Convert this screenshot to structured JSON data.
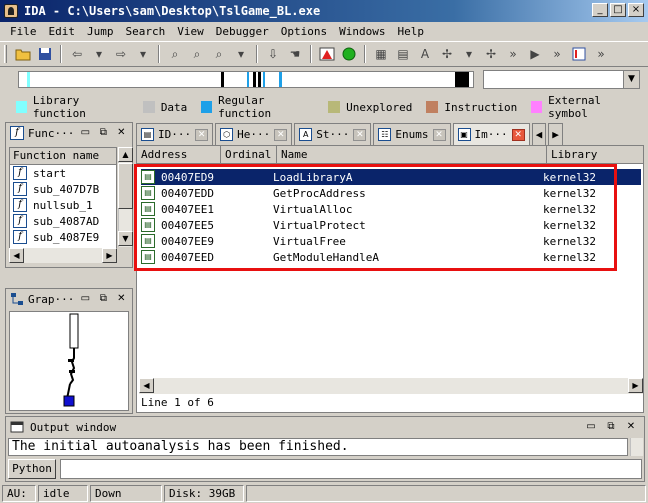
{
  "window": {
    "title": "IDA - C:\\Users\\sam\\Desktop\\TslGame_BL.exe",
    "min": "_",
    "max": "□",
    "close": "×"
  },
  "menu": [
    "File",
    "Edit",
    "Jump",
    "Search",
    "View",
    "Debugger",
    "Options",
    "Windows",
    "Help"
  ],
  "legend": [
    {
      "label": "Library function",
      "color": "#80ffff"
    },
    {
      "label": "Data",
      "color": "#c0c0c0"
    },
    {
      "label": "Regular function",
      "color": "#1ea0e8"
    },
    {
      "label": "Unexplored",
      "color": "#b8b878"
    },
    {
      "label": "Instruction",
      "color": "#c08060"
    },
    {
      "label": "External symbol",
      "color": "#ff80ff"
    }
  ],
  "functions_panel": {
    "title": "Func···",
    "column": "Function name",
    "items": [
      "start",
      "sub_407D7B",
      "nullsub_1",
      "sub_4087AD",
      "sub_4087E9"
    ]
  },
  "graph_panel": {
    "title": "Grap···"
  },
  "tabs": [
    {
      "label": "ID···",
      "icon": "IDA"
    },
    {
      "label": "He···",
      "icon": "hex"
    },
    {
      "label": "St···",
      "icon": "A"
    },
    {
      "label": "Enums",
      "icon": "enum"
    },
    {
      "label": "Im···",
      "icon": "imp",
      "active": true
    }
  ],
  "imports": {
    "columns": [
      "Address",
      "Ordinal",
      "Name",
      "Library"
    ],
    "rows": [
      {
        "address": "00407ED9",
        "ordinal": "",
        "name": "LoadLibraryA",
        "library": "kernel32"
      },
      {
        "address": "00407EDD",
        "ordinal": "",
        "name": "GetProcAddress",
        "library": "kernel32"
      },
      {
        "address": "00407EE1",
        "ordinal": "",
        "name": "VirtualAlloc",
        "library": "kernel32"
      },
      {
        "address": "00407EE5",
        "ordinal": "",
        "name": "VirtualProtect",
        "library": "kernel32"
      },
      {
        "address": "00407EE9",
        "ordinal": "",
        "name": "VirtualFree",
        "library": "kernel32"
      },
      {
        "address": "00407EED",
        "ordinal": "",
        "name": "GetModuleHandleA",
        "library": "kernel32"
      }
    ],
    "line_info": "Line 1 of 6"
  },
  "output": {
    "title": "Output window",
    "text": "The initial autoanalysis has been finished.",
    "python_label": "Python"
  },
  "status": {
    "au": "AU:",
    "state": "idle",
    "direction": "Down",
    "disk": "Disk: 39GB"
  }
}
